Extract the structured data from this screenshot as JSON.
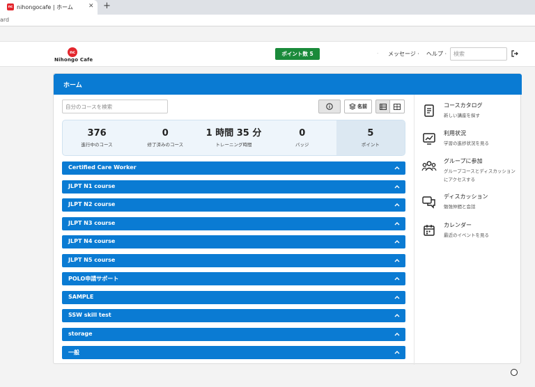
{
  "browser": {
    "tab_title": "nihongocafe | ホーム",
    "favicon_text": "nc",
    "close_glyph": "✕",
    "new_tab_glyph": "+",
    "address_fragment": "ard"
  },
  "header": {
    "logo_mark": "nc",
    "logo_text": "Nihongo Cafe",
    "points_button": "ポイント数 5",
    "nav_dot": "·",
    "messages": "メッセージ ·",
    "help": "ヘルプ ·",
    "search_placeholder": "検索",
    "icons": [
      "logout-icon"
    ]
  },
  "page": {
    "title": "ホーム",
    "course_search_placeholder": "自分のコースを検索",
    "sort_label": "名前",
    "stats": [
      {
        "value": "376",
        "label": "進行中のコース"
      },
      {
        "value": "0",
        "label": "修了済みのコース"
      },
      {
        "value": "1 時間 35 分",
        "label": "トレーニング時間"
      },
      {
        "value": "0",
        "label": "バッジ"
      },
      {
        "value": "5",
        "label": "ポイント"
      }
    ],
    "courses": [
      "Certified Care Worker",
      "JLPT N1 course",
      "JLPT N2 course",
      "JLPT N3 course",
      "JLPT N4 course",
      "JLPT N5 course",
      "POLO申請サポート",
      "SAMPLE",
      "SSW skill test",
      "storage",
      "一般"
    ]
  },
  "sidebar": {
    "items": [
      {
        "title": "コースカタログ",
        "desc": "新しい講座を探す",
        "icon": "book-icon"
      },
      {
        "title": "利用状況",
        "desc": "学習の進捗状況を見る",
        "icon": "chart-icon"
      },
      {
        "title": "グループに参加",
        "desc": "グループコースとディスカッションにアクセスする",
        "icon": "group-icon"
      },
      {
        "title": "ディスカッション",
        "desc": "勉強仲間と会話",
        "icon": "chat-icon"
      },
      {
        "title": "カレンダー",
        "desc": "最近のイベントを見る",
        "icon": "calendar-icon"
      }
    ]
  },
  "colors": {
    "primary": "#0a7bd3",
    "points_button": "#1a8a3a",
    "brand_red": "#e3262d"
  }
}
